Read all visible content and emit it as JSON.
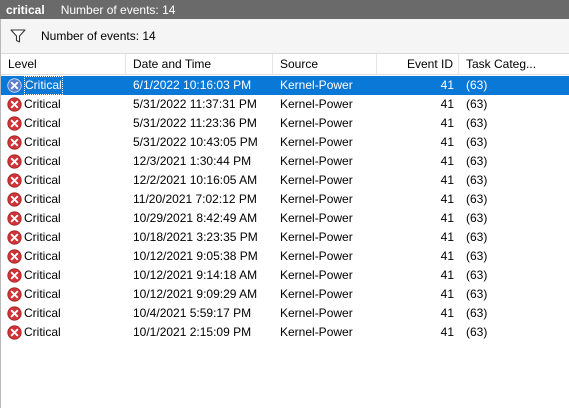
{
  "window": {
    "view_name": "critical",
    "event_count_label": "Number of events: 14"
  },
  "filter": {
    "icon": "filter-icon",
    "label": "Number of events: 14"
  },
  "columns": {
    "level": "Level",
    "date": "Date and Time",
    "source": "Source",
    "event_id": "Event ID",
    "task": "Task Categ..."
  },
  "colors": {
    "selected_row": "#0a78d7",
    "critical_icon": "#d13438",
    "titlebar": "#6a6a6a"
  },
  "rows": [
    {
      "level": "Critical",
      "date": "6/1/2022 10:16:03 PM",
      "source": "Kernel-Power",
      "event_id": "41",
      "task": "(63)",
      "selected": true
    },
    {
      "level": "Critical",
      "date": "5/31/2022 11:37:31 PM",
      "source": "Kernel-Power",
      "event_id": "41",
      "task": "(63)"
    },
    {
      "level": "Critical",
      "date": "5/31/2022 11:23:36 PM",
      "source": "Kernel-Power",
      "event_id": "41",
      "task": "(63)"
    },
    {
      "level": "Critical",
      "date": "5/31/2022 10:43:05 PM",
      "source": "Kernel-Power",
      "event_id": "41",
      "task": "(63)"
    },
    {
      "level": "Critical",
      "date": "12/3/2021 1:30:44 PM",
      "source": "Kernel-Power",
      "event_id": "41",
      "task": "(63)"
    },
    {
      "level": "Critical",
      "date": "12/2/2021 10:16:05 AM",
      "source": "Kernel-Power",
      "event_id": "41",
      "task": "(63)"
    },
    {
      "level": "Critical",
      "date": "11/20/2021 7:02:12 PM",
      "source": "Kernel-Power",
      "event_id": "41",
      "task": "(63)"
    },
    {
      "level": "Critical",
      "date": "10/29/2021 8:42:49 AM",
      "source": "Kernel-Power",
      "event_id": "41",
      "task": "(63)"
    },
    {
      "level": "Critical",
      "date": "10/18/2021 3:23:35 PM",
      "source": "Kernel-Power",
      "event_id": "41",
      "task": "(63)"
    },
    {
      "level": "Critical",
      "date": "10/12/2021 9:05:38 PM",
      "source": "Kernel-Power",
      "event_id": "41",
      "task": "(63)"
    },
    {
      "level": "Critical",
      "date": "10/12/2021 9:14:18 AM",
      "source": "Kernel-Power",
      "event_id": "41",
      "task": "(63)"
    },
    {
      "level": "Critical",
      "date": "10/12/2021 9:09:29 AM",
      "source": "Kernel-Power",
      "event_id": "41",
      "task": "(63)"
    },
    {
      "level": "Critical",
      "date": "10/4/2021 5:59:17 PM",
      "source": "Kernel-Power",
      "event_id": "41",
      "task": "(63)"
    },
    {
      "level": "Critical",
      "date": "10/1/2021 2:15:09 PM",
      "source": "Kernel-Power",
      "event_id": "41",
      "task": "(63)"
    }
  ]
}
